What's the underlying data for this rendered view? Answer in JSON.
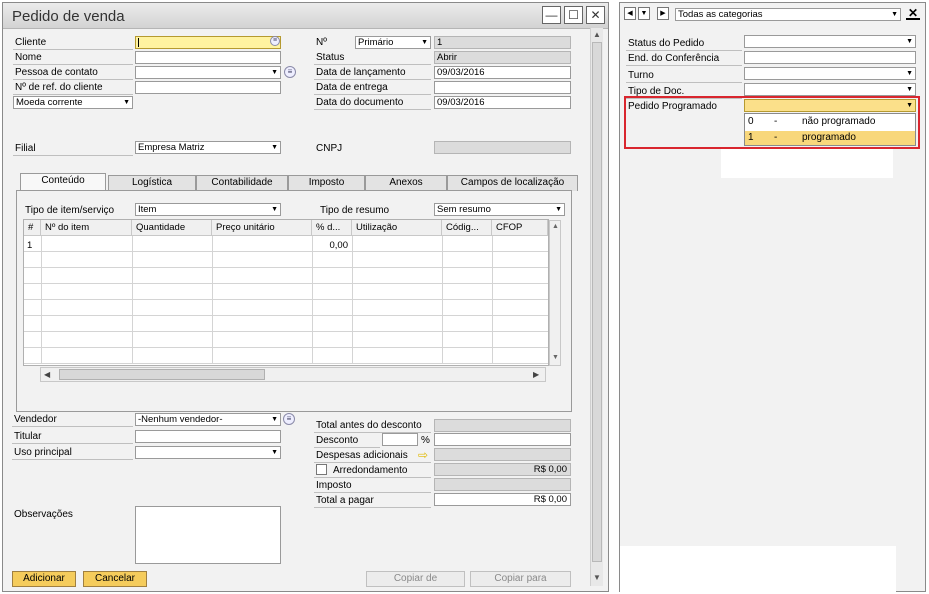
{
  "window": {
    "title": "Pedido de venda",
    "controls": {
      "minimize": "—",
      "maximize": "☐",
      "close": "✕"
    }
  },
  "header_left": {
    "cliente_label": "Cliente",
    "nome_label": "Nome",
    "pessoa_contato_label": "Pessoa de contato",
    "ref_cliente_label": "Nº de ref. do cliente",
    "moeda_value": "Moeda corrente"
  },
  "header_right": {
    "numero_label": "Nº",
    "numero_series": "Primário",
    "numero_value": "1",
    "status_label": "Status",
    "status_value": "Abrir",
    "data_lancamento_label": "Data de lançamento",
    "data_lancamento_value": "09/03/2016",
    "data_entrega_label": "Data de entrega",
    "data_documento_label": "Data do documento",
    "data_documento_value": "09/03/2016"
  },
  "filial": {
    "label": "Filial",
    "value": "Empresa Matriz",
    "cnpj_label": "CNPJ"
  },
  "tabs": [
    "Conteúdo",
    "Logística",
    "Contabilidade",
    "Imposto",
    "Anexos",
    "Campos de localização"
  ],
  "content_tab": {
    "tipo_item_label": "Tipo de item/serviço",
    "tipo_item_value": "Item",
    "tipo_resumo_label": "Tipo de resumo",
    "tipo_resumo_value": "Sem resumo",
    "grid_headers": [
      "#",
      "Nº do item",
      "Quantidade",
      "Preço unitário",
      "% d...",
      "Utilização",
      "Códig...",
      "CFOP"
    ],
    "row_number": "1",
    "row_discount": "0,00"
  },
  "footer_left": {
    "vendedor_label": "Vendedor",
    "vendedor_value": "-Nenhum vendedor-",
    "titular_label": "Titular",
    "uso_principal_label": "Uso principal",
    "observacoes_label": "Observações"
  },
  "totals": {
    "total_antes_label": "Total antes do desconto",
    "desconto_label": "Desconto",
    "desconto_pct": "%",
    "despesas_label": "Despesas adicionais",
    "arredondamento_label": "Arredondamento",
    "arredondamento_value": "R$ 0,00",
    "imposto_label": "Imposto",
    "total_pagar_label": "Total a pagar",
    "total_pagar_value": "R$ 0,00"
  },
  "buttons": {
    "adicionar": "Adicionar",
    "cancelar": "Cancelar",
    "copiar_de": "Copiar de",
    "copiar_para": "Copiar para"
  },
  "udf_panel": {
    "category": "Todas as categorias",
    "close_glyph": "✕",
    "fields": [
      "Status do Pedido",
      "End. do Conferência",
      "Turno",
      "Tipo de Doc.",
      "Pedido Programado"
    ],
    "options": [
      {
        "code": "0",
        "sep": "-",
        "label": "não programado"
      },
      {
        "code": "1",
        "sep": "-",
        "label": "programado"
      }
    ]
  },
  "colors": {
    "highlight": "#d9262e",
    "yellow_button": "#f5cc5c",
    "selected_option": "#f8d77b"
  }
}
